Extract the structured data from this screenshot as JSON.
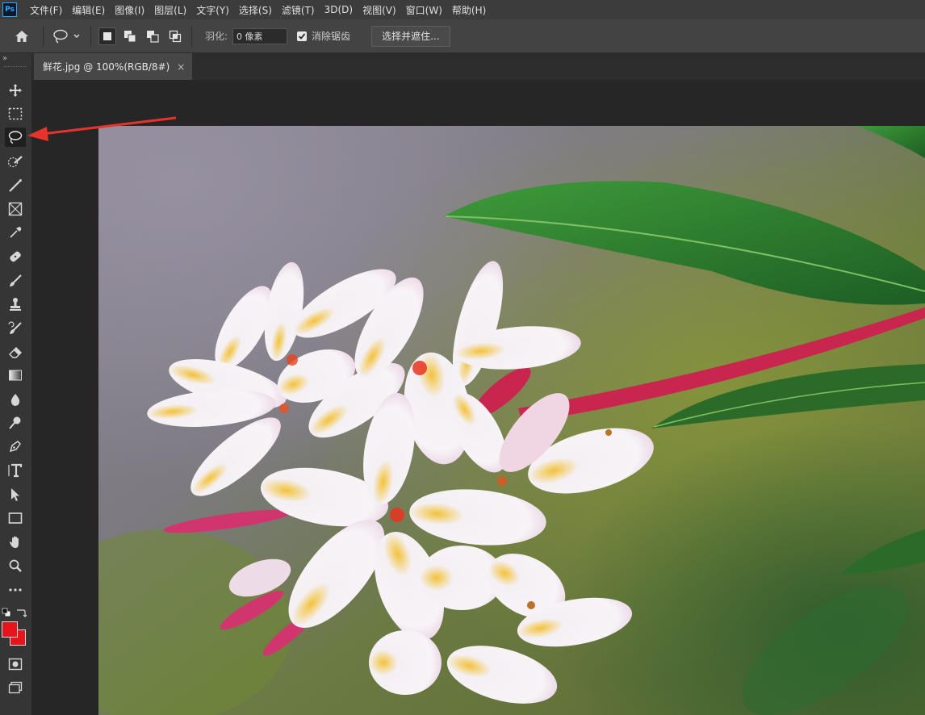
{
  "app": {
    "logo": "Ps"
  },
  "menu": [
    "文件(F)",
    "编辑(E)",
    "图像(I)",
    "图层(L)",
    "文字(Y)",
    "选择(S)",
    "滤镜(T)",
    "3D(D)",
    "视图(V)",
    "窗口(W)",
    "帮助(H)"
  ],
  "options": {
    "feather_label": "羽化:",
    "feather_value": "0 像素",
    "antialias_label": "消除锯齿",
    "antialias_checked": true,
    "select_mask_button": "选择并遮住..."
  },
  "document": {
    "tab_title": "鲜花.jpg @ 100%(RGB/8#)",
    "close_glyph": "×"
  },
  "toolbar": {
    "collapse_glyph": "»",
    "tools": [
      "move-tool",
      "marquee-tool",
      "lasso-tool",
      "quick-selection-tool",
      "crop-tool",
      "frame-tool",
      "eyedropper-tool",
      "healing-brush-tool",
      "brush-tool",
      "clone-stamp-tool",
      "history-brush-tool",
      "eraser-tool",
      "gradient-tool",
      "blur-tool",
      "dodge-tool",
      "pen-tool",
      "type-tool",
      "path-selection-tool",
      "rectangle-tool",
      "hand-tool",
      "zoom-tool",
      "more-tools"
    ],
    "active_tool": "lasso-tool",
    "foreground_color": "#e8141c",
    "background_color": "#e8141c"
  },
  "colors": {
    "accent": "#31a8ff",
    "annotation_arrow": "#e8322c"
  }
}
